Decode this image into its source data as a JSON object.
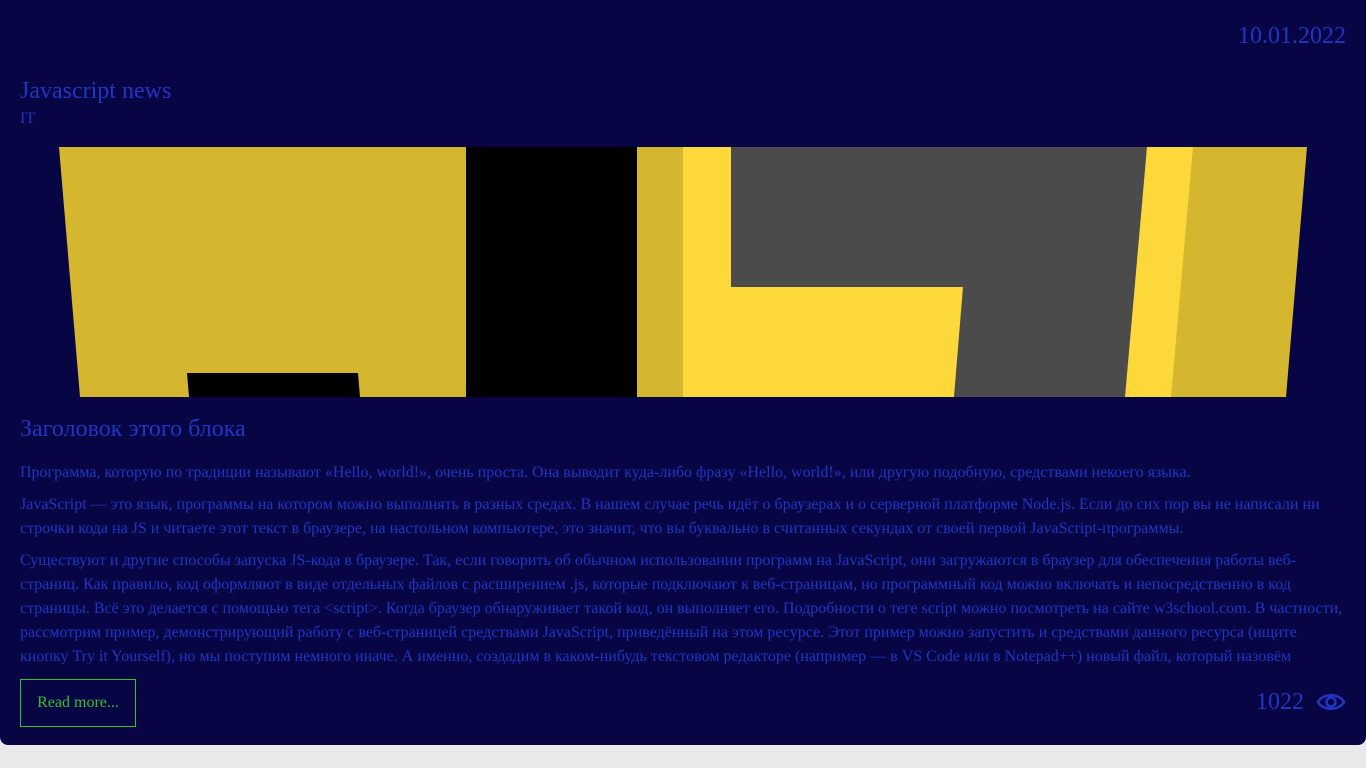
{
  "post": {
    "date": "10.01.2022",
    "title": "Javascript news",
    "category": "IT",
    "image": {
      "icon": "js-logo-banner",
      "colors": {
        "yellow": "#d4b72e",
        "bright_yellow": "#fdd83a",
        "black": "#000000",
        "gray": "#4b4b4b"
      }
    },
    "block_heading": "Заголовок этого блока",
    "paragraphs": [
      "Программа, которую по традиции называют «Hello, world!», очень проста. Она выводит куда-либо фразу «Hello, world!», или другую подобную, средствами некоего языка.",
      "JavaScript — это язык, программы на котором можно выполнять в разных средах. В нашем случае речь идёт о браузерах и о серверной платформе Node.js. Если до сих пор вы не написали ни строчки кода на JS и читаете этот текст в браузере, на настольном компьютере, это значит, что вы буквально в считанных секундах от своей первой JavaScript-программы.",
      "Существуют и другие способы запуска JS-кода в браузере. Так, если говорить об обычном использовании программ на JavaScript, они загружаются в браузер для обеспечения работы веб-страниц. Как правило, код оформляют в виде отдельных файлов с расширением .js, которые подключают к веб-страницам, но программный код можно включать и непосредственно в код страницы. Всё это делается с помощью тега <script>. Когда браузер обнаруживает такой код, он выполняет его. Подробности о теге script можно посмотреть на сайте w3school.com. В частности, рассмотрим пример, демонстрирующий работу с веб-страницей средствами JavaScript, приведённый на этом ресурсе. Этот пример можно запустить и средствами данного ресурса (ищите кнопку Try it Yourself), но мы поступим немного иначе. А именно, создадим в каком-нибудь текстовом редакторе (например — в VS Code или в Notepad++) новый файл, который назовём"
    ],
    "read_more_label": "Read more...",
    "views": "1022",
    "views_icon": "eye-icon"
  },
  "colors": {
    "card_bg": "#080545",
    "text": "#1f36c4",
    "button_border": "#2fc12f",
    "page_bg": "#e9e9eb"
  }
}
